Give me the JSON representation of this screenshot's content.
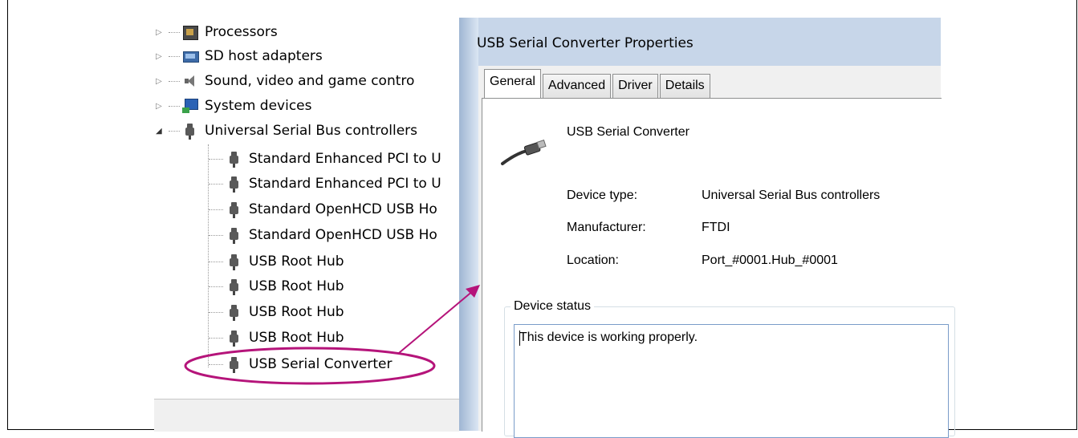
{
  "device_manager": {
    "items": [
      {
        "label": "Processors",
        "icon": "processor-icon"
      },
      {
        "label": "SD host adapters",
        "icon": "sd-host-icon"
      },
      {
        "label": "Sound, video and game contro",
        "icon": "speaker-icon"
      },
      {
        "label": "System devices",
        "icon": "system-devices-icon"
      },
      {
        "label": "Universal Serial Bus controllers",
        "icon": "usb-icon"
      }
    ],
    "usb_children": [
      {
        "label": "Standard Enhanced PCI to U"
      },
      {
        "label": "Standard Enhanced PCI to U"
      },
      {
        "label": "Standard OpenHCD USB Ho"
      },
      {
        "label": "Standard OpenHCD USB Ho"
      },
      {
        "label": "USB Root Hub"
      },
      {
        "label": "USB Root Hub"
      },
      {
        "label": "USB Root Hub"
      },
      {
        "label": "USB Root Hub"
      },
      {
        "label": "USB Serial Converter"
      }
    ]
  },
  "properties": {
    "title": "USB Serial Converter Properties",
    "tabs": [
      "General",
      "Advanced",
      "Driver",
      "Details"
    ],
    "device_name": "USB Serial Converter",
    "fields": {
      "device_type_label": "Device type:",
      "device_type_value": "Universal Serial Bus controllers",
      "manufacturer_label": "Manufacturer:",
      "manufacturer_value": "FTDI",
      "location_label": "Location:",
      "location_value": "Port_#0001.Hub_#0001"
    },
    "status_group_title": "Device status",
    "status_text": "This device is working properly."
  },
  "annotation": {
    "color": "#b5147a"
  }
}
